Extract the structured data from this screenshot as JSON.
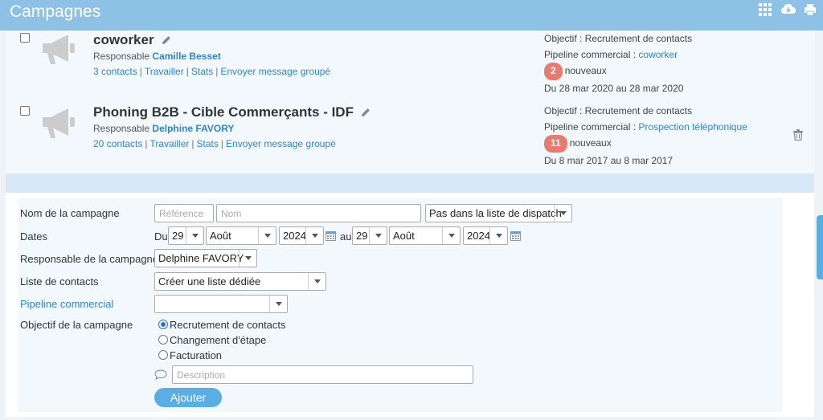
{
  "header": {
    "title": "Campagnes",
    "icons": [
      "grid-icon",
      "cloud-download-icon",
      "print-icon"
    ]
  },
  "campaigns": [
    {
      "name": "coworker",
      "responsable_label": "Responsable",
      "responsable": "Camille Besset",
      "links": [
        "3 contacts",
        "Travailler",
        "Stats",
        "Envoyer message groupé"
      ],
      "objectif": "Objectif : Recrutement de contacts",
      "pipeline_label": "Pipeline commercial :",
      "pipeline": "coworker",
      "badge": "2",
      "badge_text": "nouveaux",
      "dates": "Du 28 mar 2020 au 28 mar 2020"
    },
    {
      "name": "Phoning B2B - Cible Commerçants - IDF",
      "responsable_label": "Responsable",
      "responsable": "Delphine FAVORY",
      "links": [
        "20 contacts",
        "Travailler",
        "Stats",
        "Envoyer message groupé"
      ],
      "objectif": "Objectif : Recrutement de contacts",
      "pipeline_label": "Pipeline commercial :",
      "pipeline": "Prospection téléphonique",
      "badge": "11",
      "badge_text": "nouveaux",
      "dates": "Du  8 mar 2017 au  8 mar 2017"
    }
  ],
  "form": {
    "labels": {
      "nom": "Nom de la campagne",
      "dates": "Dates",
      "responsable": "Responsable de la campagne",
      "liste": "Liste de contacts",
      "pipeline": "Pipeline commercial",
      "objectif": "Objectif de la campagne"
    },
    "reference_placeholder": "Référence",
    "nom_placeholder": "Nom",
    "dispatch": "Pas dans la liste de dispatch",
    "du": "Du",
    "au": "au",
    "start": {
      "day": "29",
      "month": "Août",
      "year": "2024"
    },
    "end": {
      "day": "29",
      "month": "Août",
      "year": "2024"
    },
    "responsable_value": "Delphine FAVORY",
    "liste_value": "Créer une liste dédiée",
    "pipeline_value": "",
    "objectifs": [
      "Recrutement de contacts",
      "Changement d'étape",
      "Facturation"
    ],
    "objectif_selected": 0,
    "description_placeholder": "Description",
    "submit": "Ajouter"
  }
}
